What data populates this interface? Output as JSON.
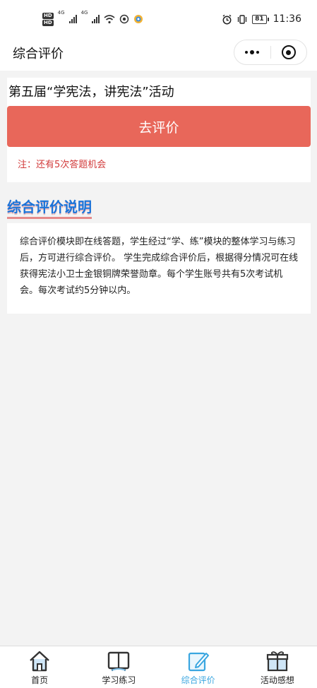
{
  "status_bar": {
    "hd": "HD",
    "net": "4G",
    "battery": "81",
    "time": "11:36"
  },
  "nav": {
    "title": "综合评价"
  },
  "activity": {
    "title": "第五届“学宪法，讲宪法”活动",
    "button_label": "去评价",
    "note": "注：还有5次答题机会"
  },
  "section": {
    "heading": "综合评价说明"
  },
  "description": {
    "text": "综合评价模块即在线答题，学生经过“学、练”模块的整体学习与练习后，方可进行综合评价。 学生完成综合评价后，根据得分情况可在线获得宪法小卫士金银铜牌荣誉勋章。每个学生账号共有5次考试机会。每次考试约5分钟以内。"
  },
  "tabs": [
    {
      "label": "首页",
      "icon": "home-icon"
    },
    {
      "label": "学习练习",
      "icon": "book-icon"
    },
    {
      "label": "综合评价",
      "icon": "edit-icon",
      "active": true
    },
    {
      "label": "活动感想",
      "icon": "gift-icon"
    }
  ],
  "colors": {
    "button": "#e8675a",
    "note": "#d23b3b",
    "heading": "#1a73d9",
    "active_tab": "#3aa6e0"
  }
}
